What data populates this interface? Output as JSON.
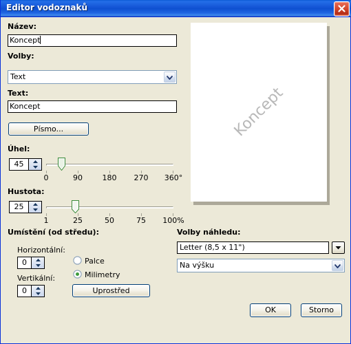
{
  "window": {
    "title": "Editor vodoznaků",
    "close_icon": "close-icon",
    "accent_titlebar": "#0a5ad4",
    "dialog_bg": "#ece9d8"
  },
  "fields": {
    "name_label": "Název:",
    "name_value": "Koncept",
    "options_label": "Volby:",
    "options_value": "Text",
    "text_label": "Text:",
    "text_value": "Koncept",
    "font_button": "Písmo..."
  },
  "angle": {
    "label": "Úhel:",
    "value": "45",
    "ticks": [
      "0",
      "90",
      "180",
      "270",
      "360°"
    ],
    "min": 0,
    "max": 360,
    "current": 45
  },
  "density": {
    "label": "Hustota:",
    "value": "25",
    "ticks": [
      "1",
      "25",
      "50",
      "75",
      "100%"
    ],
    "min": 1,
    "max": 100,
    "current": 25
  },
  "placement": {
    "group_label": "Umístění (od středu):",
    "horizontal_label": "Horizontální:",
    "horizontal_value": "0",
    "vertical_label": "Vertikální:",
    "vertical_value": "0",
    "unit_inches": "Palce",
    "unit_mm": "Milimetry",
    "unit_selected": "Milimetry",
    "center_button": "Uprostřed"
  },
  "preview_options": {
    "label": "Volby náhledu:",
    "paper_value": "Letter (8,5 x 11\")",
    "orientation_value": "Na výšku"
  },
  "preview": {
    "watermark_text": "Koncept",
    "watermark_color": "#b8b8b8",
    "page_color": "#ffffff",
    "shadow_color": "#aca899"
  },
  "footer": {
    "ok_label": "OK",
    "cancel_label": "Storno"
  },
  "icons": {
    "chevron_down": "chevron-down-icon",
    "triangle_down": "triangle-down-icon",
    "spinner_up": "spinner-up-icon",
    "spinner_down": "spinner-down-icon"
  }
}
